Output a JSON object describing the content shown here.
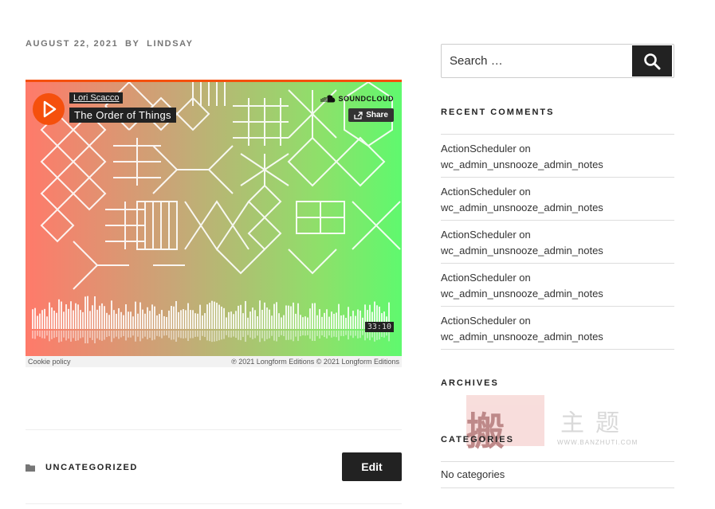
{
  "post": {
    "date": "AUGUST 22, 2021",
    "by": "BY",
    "author": "LINDSAY",
    "category_label": "UNCATEGORIZED",
    "edit_label": "Edit"
  },
  "soundcloud": {
    "artist": "Lori Scacco",
    "track": "The Order of Things",
    "logo_text": "SOUNDCLOUD",
    "share_label": "Share",
    "duration": "33:10",
    "cookie_policy": "Cookie policy",
    "copyright": "℗ 2021 Longform Editions © 2021 Longform Editions",
    "accent_color": "#f5500d"
  },
  "sidebar": {
    "search_placeholder": "Search …",
    "recent_comments_title": "RECENT COMMENTS",
    "comments": [
      {
        "author": "ActionScheduler",
        "on": "on",
        "link": "wc_admin_unsnooze_admin_notes"
      },
      {
        "author": "ActionScheduler",
        "on": "on",
        "link": "wc_admin_unsnooze_admin_notes"
      },
      {
        "author": "ActionScheduler",
        "on": "on",
        "link": "wc_admin_unsnooze_admin_notes"
      },
      {
        "author": "ActionScheduler",
        "on": "on",
        "link": "wc_admin_unsnooze_admin_notes"
      },
      {
        "author": "ActionScheduler",
        "on": "on",
        "link": "wc_admin_unsnooze_admin_notes"
      }
    ],
    "archives_title": "ARCHIVES",
    "categories_title": "CATEGORIES",
    "categories": [
      "No categories"
    ]
  },
  "watermark": {
    "main": "搬",
    "cn": "主题",
    "url": "WWW.BANZHUTI.COM"
  }
}
